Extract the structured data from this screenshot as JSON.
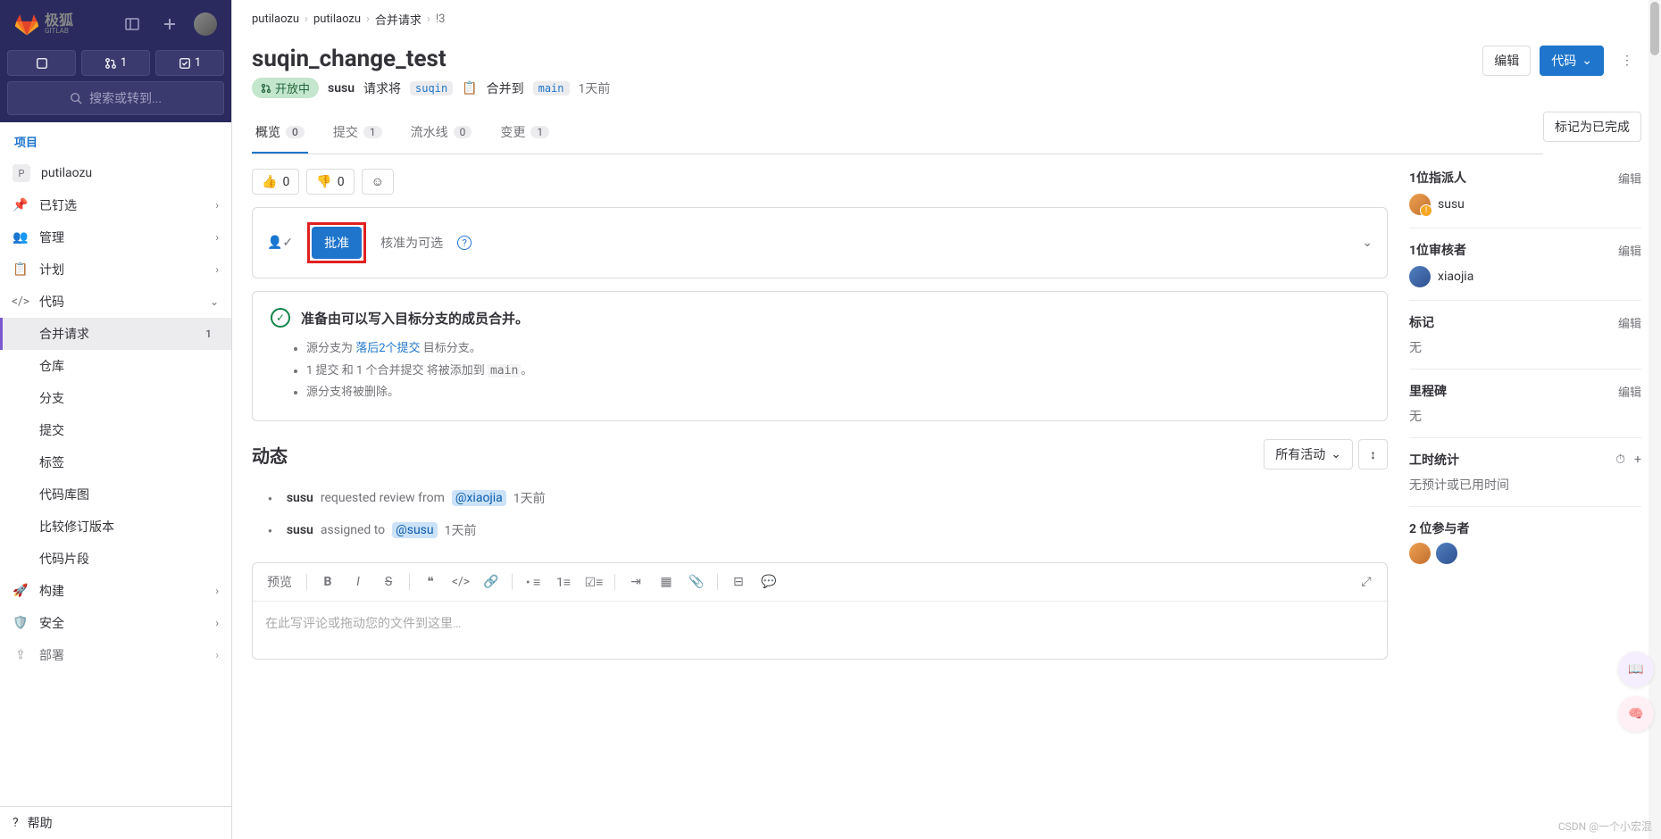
{
  "logo": "极狐",
  "logo_sub": "GITLAB",
  "top_counts": {
    "mr": "1",
    "todo": "1"
  },
  "search_placeholder": "搜索或转到...",
  "section_label": "项目",
  "project": {
    "initial": "P",
    "name": "putilaozu"
  },
  "nav": {
    "pinned": "已钉选",
    "manage": "管理",
    "plan": "计划",
    "code": "代码",
    "merge_requests": "合并请求",
    "mr_count": "1",
    "repo": "仓库",
    "branches": "分支",
    "commits": "提交",
    "tags": "标签",
    "graph": "代码库图",
    "compare": "比较修订版本",
    "snippets": "代码片段",
    "build": "构建",
    "secure": "安全",
    "deploy": "部署"
  },
  "help": "帮助",
  "breadcrumb": {
    "p1": "putilaozu",
    "p2": "putilaozu",
    "p3": "合并请求",
    "p4": "!3"
  },
  "mr": {
    "title": "suqin_change_test",
    "status": "开放中",
    "author": "susu",
    "requests": "请求将",
    "source_branch": "suqin",
    "merge_into": "合并到",
    "target_branch": "main",
    "time": "1天前"
  },
  "header_actions": {
    "edit": "编辑",
    "code": "代码"
  },
  "tabs": {
    "overview": "概览",
    "overview_count": "0",
    "commits": "提交",
    "commits_count": "1",
    "pipelines": "流水线",
    "pipelines_count": "0",
    "changes": "变更",
    "changes_count": "1",
    "mark_done": "标记为已完成"
  },
  "reactions": {
    "up": "0",
    "down": "0"
  },
  "approval": {
    "approve": "批准",
    "optional": "核准为可选"
  },
  "merge": {
    "ready": "准备由可以写入目标分支的成员合并。",
    "behind_prefix": "源分支为",
    "behind_link": "落后2个提交",
    "behind_suffix": "目标分支。",
    "adds": "1 提交 和 1 个合并提交 将被添加到",
    "adds_branch": "main",
    "delete": "源分支将被删除。"
  },
  "activity": {
    "title": "动态",
    "filter": "所有活动",
    "items": [
      {
        "user": "susu",
        "action": "requested review from",
        "target": "@xiaojia",
        "time": "1天前"
      },
      {
        "user": "susu",
        "action": "assigned to",
        "target": "@susu",
        "time": "1天前"
      }
    ]
  },
  "editor": {
    "preview": "预览",
    "placeholder": "在此写评论或拖动您的文件到这里…"
  },
  "side": {
    "assignee_title": "1位指派人",
    "assignee_name": "susu",
    "reviewer_title": "1位审核者",
    "reviewer_name": "xiaojia",
    "labels_title": "标记",
    "none": "无",
    "milestone_title": "里程碑",
    "time_title": "工时统计",
    "time_text": "无预计或已用时间",
    "participants_title": "2 位参与者",
    "edit": "编辑"
  },
  "watermark": "CSDN @一个小宏混"
}
